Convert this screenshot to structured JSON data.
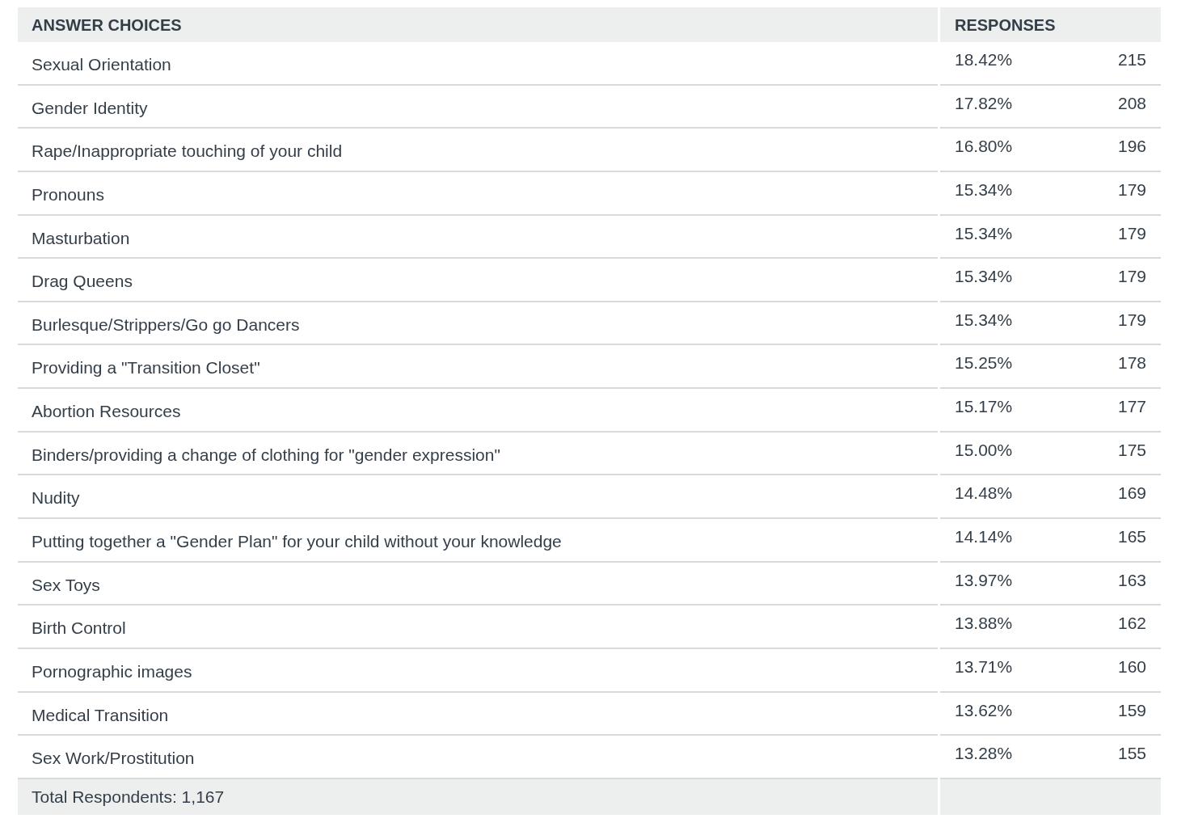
{
  "table": {
    "columns": [
      "ANSWER CHOICES",
      "RESPONSES"
    ],
    "rows": [
      {
        "choice": "Sexual Orientation",
        "percent": "18.42%",
        "count": "215"
      },
      {
        "choice": "Gender Identity",
        "percent": "17.82%",
        "count": "208"
      },
      {
        "choice": "Rape/Inappropriate touching of your child",
        "percent": "16.80%",
        "count": "196"
      },
      {
        "choice": "Pronouns",
        "percent": "15.34%",
        "count": "179"
      },
      {
        "choice": "Masturbation",
        "percent": "15.34%",
        "count": "179"
      },
      {
        "choice": "Drag Queens",
        "percent": "15.34%",
        "count": "179"
      },
      {
        "choice": "Burlesque/Strippers/Go go Dancers",
        "percent": "15.34%",
        "count": "179"
      },
      {
        "choice": "Providing a \"Transition Closet\"",
        "percent": "15.25%",
        "count": "178"
      },
      {
        "choice": "Abortion Resources",
        "percent": "15.17%",
        "count": "177"
      },
      {
        "choice": "Binders/providing a change of clothing for \"gender expression\"",
        "percent": "15.00%",
        "count": "175"
      },
      {
        "choice": "Nudity",
        "percent": "14.48%",
        "count": "169"
      },
      {
        "choice": "Putting together a \"Gender Plan\" for your child without your knowledge",
        "percent": "14.14%",
        "count": "165"
      },
      {
        "choice": "Sex Toys",
        "percent": "13.97%",
        "count": "163"
      },
      {
        "choice": "Birth Control",
        "percent": "13.88%",
        "count": "162"
      },
      {
        "choice": "Pornographic images",
        "percent": "13.71%",
        "count": "160"
      },
      {
        "choice": "Medical Transition",
        "percent": "13.62%",
        "count": "159"
      },
      {
        "choice": "Sex Work/Prostitution",
        "percent": "13.28%",
        "count": "155"
      }
    ],
    "footer": "Total Respondents: 1,167"
  }
}
